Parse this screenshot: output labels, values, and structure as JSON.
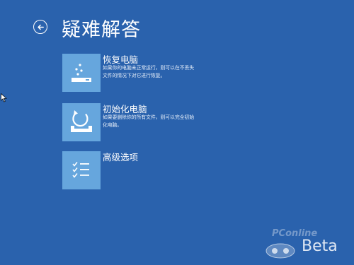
{
  "page": {
    "title": "疑难解答"
  },
  "options": [
    {
      "label": "恢复电脑",
      "description": "如果你的电脑未正常运行，则可以在不丢失文件的情况下对它进行恢复。",
      "icon": "refresh-pc-icon"
    },
    {
      "label": "初始化电脑",
      "description": "如果要删除你的所有文件，则可以完全初始化电脑。",
      "icon": "reset-pc-icon"
    },
    {
      "label": "高级选项",
      "description": "",
      "icon": "checklist-icon"
    }
  ],
  "watermark": {
    "site": "PConline",
    "badge": "Beta"
  },
  "colors": {
    "background": "#2a62ad",
    "tile": "#66a6dd",
    "text": "#ffffff"
  },
  "icons": {
    "back": "back-arrow-icon",
    "cursor": "mouse-pointer-icon"
  }
}
